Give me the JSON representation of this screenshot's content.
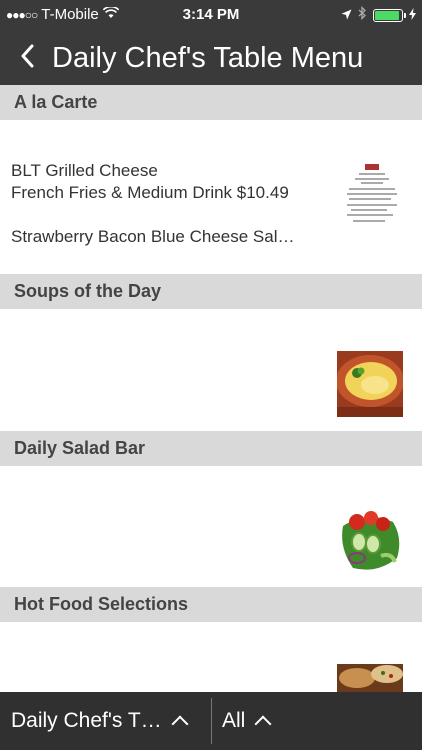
{
  "status": {
    "carrier": "T-Mobile",
    "time": "3:14 PM",
    "signal_dots": "●●●○○"
  },
  "header": {
    "back_icon": "chevron-left-icon",
    "title": "Daily Chef's Table Menu"
  },
  "sections": [
    {
      "title": "A la Carte",
      "lines": [
        "BLT Grilled Cheese",
        "French Fries & Medium Drink $10.49",
        "",
        "Strawberry Bacon Blue Cheese Sal…"
      ]
    },
    {
      "title": "Soups of the Day"
    },
    {
      "title": "Daily Salad Bar"
    },
    {
      "title": "Hot Food Selections"
    }
  ],
  "bottom_bar": {
    "menu_label": "Daily Chef's T…",
    "filter_label": "All"
  },
  "colors": {
    "bar_bg": "#3a3a3a",
    "section_header_bg": "#d9d9d9",
    "battery": "#4cd964"
  }
}
